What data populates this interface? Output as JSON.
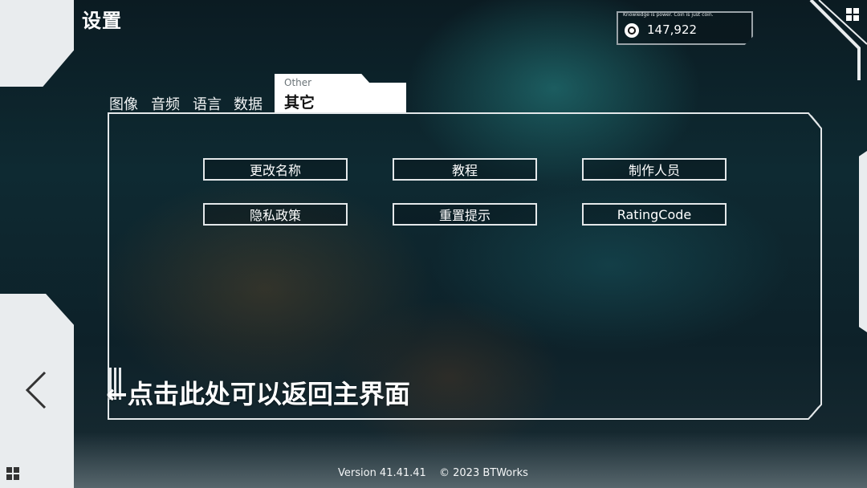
{
  "header": {
    "title": "设置"
  },
  "currency": {
    "motto": "Knowledge is power. Coin is just coin.",
    "amount": "147,922",
    "icon": "coin-icon"
  },
  "tabs": [
    {
      "label": "图像"
    },
    {
      "label": "音频"
    },
    {
      "label": "语言"
    },
    {
      "label": "数据"
    }
  ],
  "active_tab": {
    "label_en": "Other",
    "label": "其它"
  },
  "options": [
    {
      "label": "更改名称"
    },
    {
      "label": "教程"
    },
    {
      "label": "制作人员"
    },
    {
      "label": "隐私政策"
    },
    {
      "label": "重置提示"
    },
    {
      "label": "RatingCode"
    }
  ],
  "hint": {
    "text": "←点击此处可以返回主界面"
  },
  "footer": {
    "version": "Version 41.41.41",
    "copyright": "© 2023 BTWorks"
  },
  "icons": {
    "back": "chevron-left-icon",
    "menu": "grid-menu-icon"
  },
  "colors": {
    "accent": "#ffffff",
    "panel_border": "#e4e8ea",
    "plate": "#e9ecee"
  }
}
